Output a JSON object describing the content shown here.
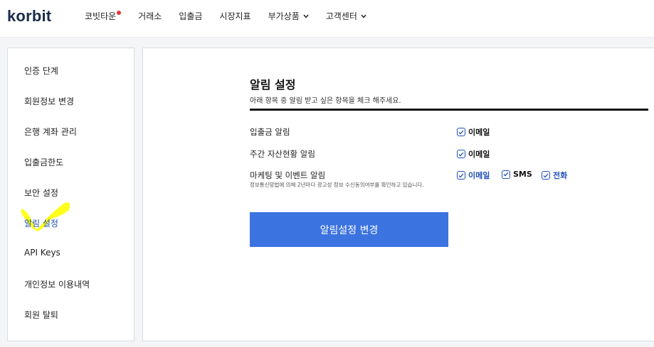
{
  "header": {
    "logo": "korbit",
    "nav": [
      {
        "label": "코빗타운",
        "has_dot": true
      },
      {
        "label": "거래소"
      },
      {
        "label": "입출금"
      },
      {
        "label": "시장지표"
      },
      {
        "label": "부가상품",
        "has_chevron": true
      },
      {
        "label": "고객센터",
        "has_chevron": true
      }
    ]
  },
  "sidebar": {
    "items": [
      {
        "label": "인증 단계"
      },
      {
        "label": "회원정보 변경"
      },
      {
        "label": "은행 계좌 관리"
      },
      {
        "label": "입출금한도"
      },
      {
        "label": "보안 설정"
      },
      {
        "label": "알림 설정",
        "active": true
      },
      {
        "label": "API Keys"
      },
      {
        "label": "개인정보 이용내역"
      },
      {
        "label": "회원 탈퇴"
      }
    ]
  },
  "main": {
    "title": "알림 설정",
    "subtitle": "아래 항목 중 알림 받고 싶은 항목을 체크 해주세요.",
    "rows": [
      {
        "label": "입출금 알림",
        "options": [
          {
            "label": "이메일",
            "checked": true
          }
        ]
      },
      {
        "label": "주간 자산현황 알림",
        "options": [
          {
            "label": "이메일",
            "checked": true
          }
        ]
      },
      {
        "label": "마케팅 및 이벤트 알림",
        "note": "정보통신망법에 의해 2년마다 광고성 정보 수신동의여부를 확인하고 있습니다.",
        "options": [
          {
            "label": "이메일",
            "checked": true
          },
          {
            "label": "SMS",
            "checked": true
          },
          {
            "label": "전화",
            "checked": true
          }
        ]
      }
    ],
    "submit_label": "알림설정 변경"
  },
  "colors": {
    "accent": "#1f4fb8",
    "button": "#3b73e0",
    "highlight": "#ffff00",
    "badge": "#e53935"
  }
}
